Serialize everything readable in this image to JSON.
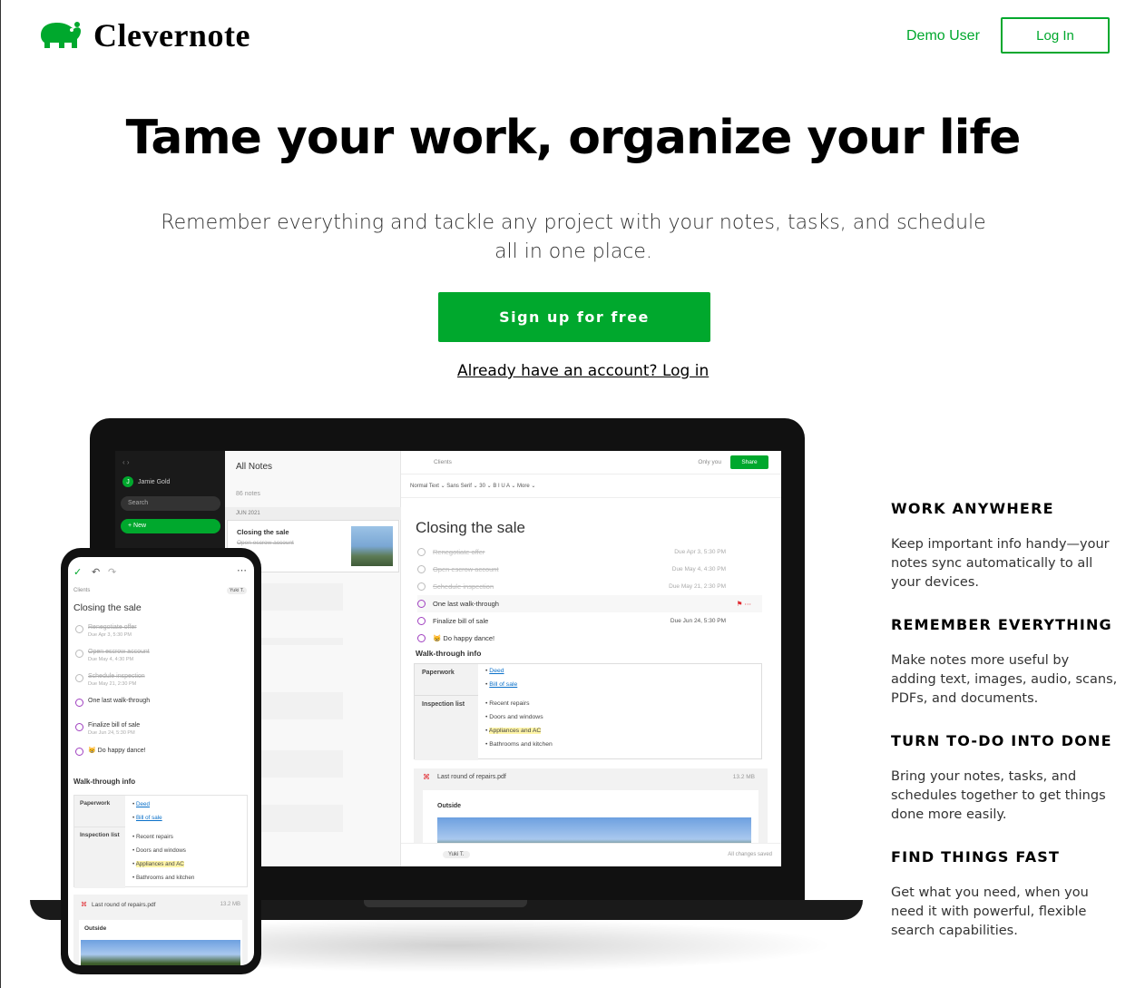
{
  "header": {
    "brand": "Clevernote",
    "demo_user": "Demo User",
    "login": "Log In"
  },
  "hero": {
    "title": "Tame your work, organize your life",
    "subtitle": "Remember everything and tackle any project with your notes, tasks, and schedule all in one place.",
    "signup": "Sign up for free",
    "already": "Already have an account? Log in"
  },
  "features": [
    {
      "title": "WORK ANYWHERE",
      "text": "Keep important info handy—your notes sync automatically to all your devices."
    },
    {
      "title": "REMEMBER EVERYTHING",
      "text": "Make notes more useful by adding text, images, audio, scans, PDFs, and documents."
    },
    {
      "title": "TURN TO-DO INTO DONE",
      "text": "Bring your notes, tasks, and schedules together to get things done more easily."
    },
    {
      "title": "FIND THINGS FAST",
      "text": "Get what you need, when you need it with powerful, flexible search capabilities."
    }
  ],
  "desktop_app": {
    "user": "Jamie Gold",
    "search": "Search",
    "new": "+ New",
    "list_title": "All Notes",
    "note_count": "86 notes",
    "month": "JUN 2021",
    "card_title": "Closing the sale",
    "card_sub": "Open escrow account",
    "breadcrumb": "Clients",
    "visibility": "Only you",
    "share": "Share",
    "toolbar": "Normal Text ⌄   Sans Serif ⌄   30 ⌄   B  I  U  A ⌄   More ⌄",
    "note_title": "Closing the sale",
    "tasks": [
      {
        "text": "Renegotiate offer",
        "due": "Due Apr 3, 5:30 PM",
        "done": true
      },
      {
        "text": "Open escrow account",
        "due": "Due May 4, 4:30 PM",
        "done": true
      },
      {
        "text": "Schedule inspection",
        "due": "Due May 21, 2:30 PM",
        "done": true
      },
      {
        "text": "One last walk-through",
        "due": "",
        "done": false
      },
      {
        "text": "Finalize bill of sale",
        "due": "Due Jun 24, 5:30 PM",
        "done": false
      },
      {
        "text": "😸 Do happy dance!",
        "due": "",
        "done": false
      }
    ],
    "section": "Walk-through info",
    "table": {
      "row1_label": "Paperwork",
      "row1_items": [
        "Deed",
        "Bill of sale"
      ],
      "row2_label": "Inspection list",
      "row2_items": [
        "Recent repairs",
        "Doors and windows",
        "Appliances and AC",
        "Bathrooms and kitchen"
      ]
    },
    "pdf_name": "Last round of repairs.pdf",
    "pdf_size": "13.2 MB",
    "pdf_heading": "Outside",
    "assignee": "Yuki T.",
    "saved": "All changes saved"
  },
  "phone_app": {
    "breadcrumb": "Clients",
    "assignee": "Yuki T.",
    "note_title": "Closing the sale",
    "tasks": [
      {
        "text": "Renegotiate offer",
        "due": "Due Apr 3, 5:30 PM",
        "done": true
      },
      {
        "text": "Open escrow account",
        "due": "Due May 4, 4:30 PM",
        "done": true
      },
      {
        "text": "Schedule inspection",
        "due": "Due May 21, 2:30 PM",
        "done": true
      },
      {
        "text": "One last walk-through",
        "due": "",
        "done": false
      },
      {
        "text": "Finalize bill of sale",
        "due": "Due Jun 24, 5:30 PM",
        "done": false
      },
      {
        "text": "😸 Do happy dance!",
        "due": "",
        "done": false
      }
    ],
    "section": "Walk-through info",
    "pdf_name": "Last round of repairs.pdf",
    "pdf_size": "13.2 MB",
    "pdf_heading": "Outside"
  },
  "colors": {
    "brand": "#00a82d",
    "text": "#333333"
  }
}
